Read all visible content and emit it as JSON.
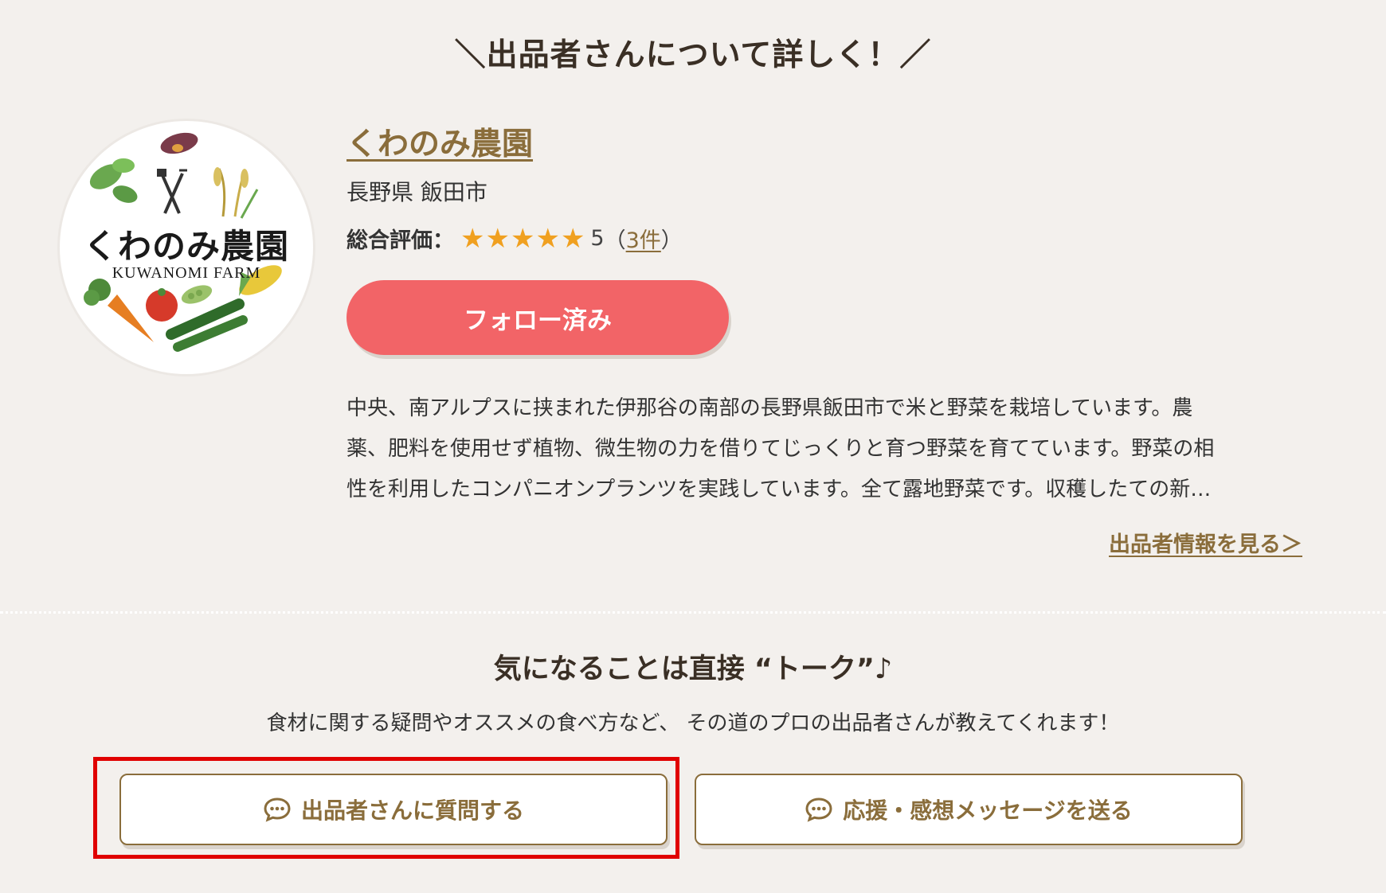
{
  "section_heading": "＼出品者さんについて詳しく！／",
  "logo": {
    "title": "くわのみ農園",
    "subtitle": "KUWANOMI FARM"
  },
  "farm": {
    "name": "くわのみ農園",
    "location": "長野県 飯田市"
  },
  "rating": {
    "label": "総合評価：",
    "stars": 5,
    "score": "5",
    "open_paren": "（",
    "count": "3件",
    "close_paren": "）"
  },
  "follow_button": "フォロー済み",
  "description_lines": [
    "中央、南アルプスに挟まれた伊那谷の南部の長野県飯田市で米と野菜を栽培しています。農",
    "薬、肥料を使用せず植物、微生物の力を借りてじっくりと育つ野菜を育てています。野菜の相",
    "性を利用したコンパニオンプランツを実践しています。全て露地野菜です。収穫したての新…"
  ],
  "seller_info_link": "出品者情報を見る＞",
  "talk": {
    "heading": "気になることは直接 “トーク”♪",
    "subtext": "食材に関する疑問やオススメの食べ方など、 その道のプロの出品者さんが教えてくれます！",
    "ask_button": "出品者さんに質問する",
    "cheer_button": "応援・感想メッセージを送る"
  },
  "colors": {
    "background": "#f3f0ed",
    "accent_brown": "#8a6d3b",
    "follow_button": "#f26467",
    "star": "#f0a020",
    "highlight_border": "#e00000"
  }
}
